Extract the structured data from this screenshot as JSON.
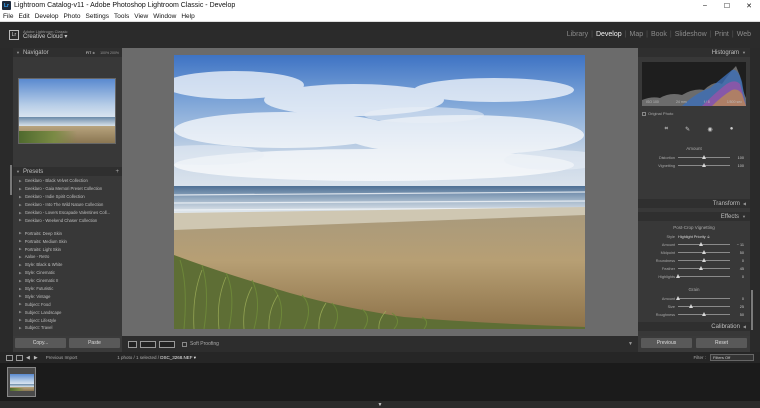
{
  "window": {
    "title": "Lightroom Catalog-v11 - Adobe Photoshop Lightroom Classic - Develop",
    "app_icon": "Lr",
    "minimize": "–",
    "maximize": "☐",
    "close": "✕"
  },
  "menu": [
    "File",
    "Edit",
    "Develop",
    "Photo",
    "Settings",
    "Tools",
    "View",
    "Window",
    "Help"
  ],
  "identity": {
    "logo": "Lr",
    "line1": "Adobe Lightroom Classic",
    "line2": "Creative Cloud",
    "caret": "▾"
  },
  "modules": [
    "Library",
    "Develop",
    "Map",
    "Book",
    "Slideshow",
    "Print",
    "Web"
  ],
  "active_module": "Develop",
  "navigator": {
    "title": "Navigator",
    "zoom_fit": "FIT ≑",
    "zoom_100": "100%",
    "zoom_200": "200%"
  },
  "presets": {
    "title": "Presets",
    "add": "+",
    "group1": [
      "Geeklaro - Black Velvet Collection",
      "Geeklaro - Gaia Memori Preset Collection",
      "Geeklaro - Indie Spirit Collection",
      "Geeklaro - Into The Wild Nature Collection",
      "Geeklaro - Lovers Escapade Valentines Coll...",
      "Geeklaro - Weekend Chaser Collection"
    ],
    "group2": [
      "Portraits: Deep Skin",
      "Portraits: Medium Skin",
      "Portraits: Light Skin",
      "Aaloe - Retro",
      "Style: Black & White",
      "Style: Cinematic",
      "Style: Cinematic II",
      "Style: Futuristic",
      "Style: Vintage",
      "Subject: Food",
      "Subject: Landscape",
      "Subject: Lifestyle",
      "Subject: Travel"
    ]
  },
  "left_buttons": {
    "copy": "Copy...",
    "paste": "Paste"
  },
  "toolbar": {
    "soft_proofing": "Soft Proofing"
  },
  "right_panel": {
    "histogram_title": "Histogram",
    "histogram_info": [
      "ISO 100",
      "24 mm",
      "f / 8",
      "1/500 sec"
    ],
    "original_photo": "Original Photo",
    "tool_icons": [
      "crop-icon",
      "heal-icon",
      "redeye-icon",
      "mask-icon"
    ],
    "lens_sub": "Amount",
    "lens_sliders": [
      {
        "label": "Distortion",
        "value": "100",
        "pos": 0.5
      },
      {
        "label": "Vignetting",
        "value": "100",
        "pos": 0.5
      }
    ],
    "transform_title": "Transform",
    "effects_title": "Effects",
    "vignette_sub": "Post-Crop Vignetting",
    "style_label": "Style",
    "style_value": "Highlight Priority ≑",
    "vignette_sliders": [
      {
        "label": "Amount",
        "value": "− 11",
        "pos": 0.44
      },
      {
        "label": "Midpoint",
        "value": "50",
        "pos": 0.5
      },
      {
        "label": "Roundness",
        "value": "0",
        "pos": 0.5
      },
      {
        "label": "Feather",
        "value": "45",
        "pos": 0.45
      },
      {
        "label": "Highlights",
        "value": "0",
        "pos": 0.0
      }
    ],
    "grain_sub": "Grain",
    "grain_sliders": [
      {
        "label": "Amount",
        "value": "0",
        "pos": 0.0
      },
      {
        "label": "Size",
        "value": "25",
        "pos": 0.25
      },
      {
        "label": "Roughness",
        "value": "50",
        "pos": 0.5
      }
    ],
    "calibration_title": "Calibration"
  },
  "right_buttons": {
    "previous": "Previous",
    "reset": "Reset"
  },
  "filmstrip": {
    "source": "Previous Import",
    "count": "1 photo / 1 selected /",
    "filename": "DSC_3268.NEF ▾",
    "filter_label": "Filter :",
    "filter_value": "Filters Off"
  },
  "bottom_toggle": "▼"
}
